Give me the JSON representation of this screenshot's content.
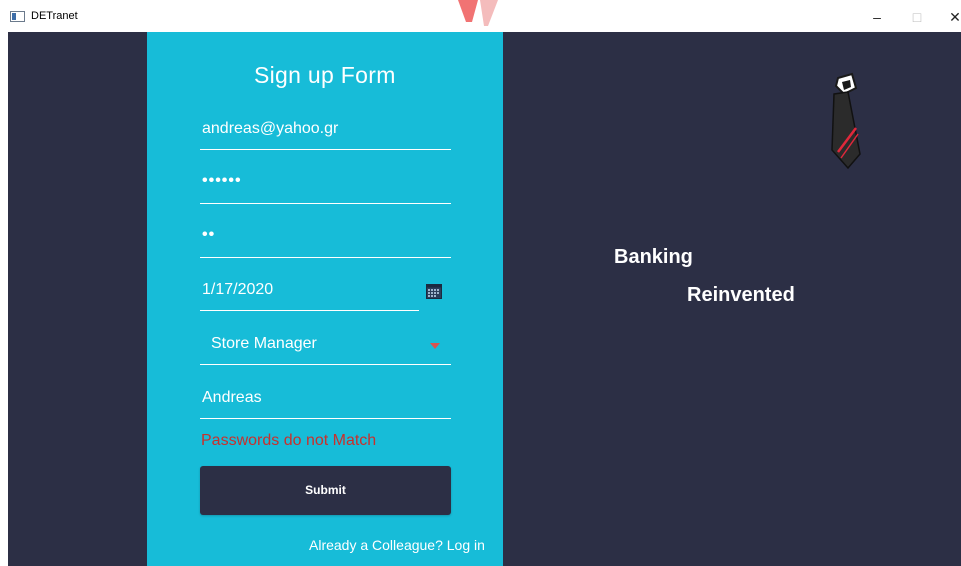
{
  "window": {
    "title": "DETranet",
    "controls": {
      "minimize": "–",
      "maximize": "□",
      "close": "✕"
    }
  },
  "form": {
    "title": "Sign up Form",
    "email_value": "andreas@yahoo.gr",
    "password_mask": "••••••",
    "confirm_password_mask": "••",
    "date_value": "1/17/2020",
    "role_selected": "Store Manager",
    "name_value": "Andreas",
    "error_message": "Passwords do not Match",
    "submit_label": "Submit",
    "login_link": "Already a Colleague? Log in"
  },
  "tagline": {
    "line1": "Banking",
    "line2": "Reinvented"
  },
  "icons": {
    "app": "app-window-icon",
    "calendar": "calendar-icon",
    "dropdown": "chevron-down-icon",
    "logo": "tie-logo-icon"
  },
  "colors": {
    "form_background": "#17bcd8",
    "dark_background": "#2c2f45",
    "error": "#c9302c",
    "accent_red": "#e0283b"
  }
}
